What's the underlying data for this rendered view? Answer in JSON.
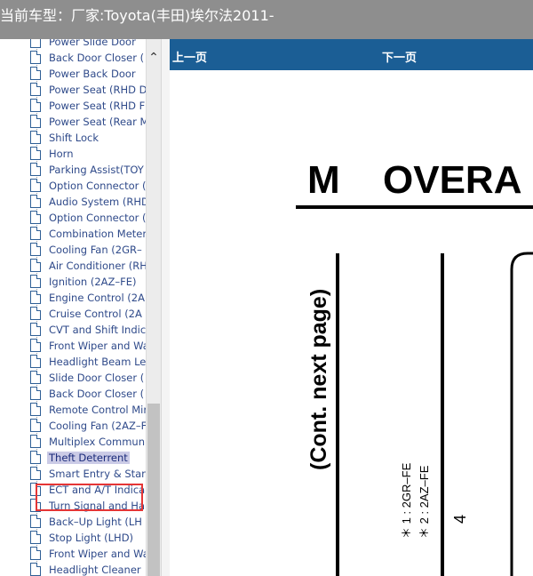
{
  "window": {
    "title": "当前车型：厂家:Toyota(丰田)埃尔法2011-"
  },
  "tree": {
    "items": [
      {
        "label": "Power Slide Door"
      },
      {
        "label": "Back Door Closer ("
      },
      {
        "label": "Power Back Door"
      },
      {
        "label": "Power Seat (RHD D"
      },
      {
        "label": "Power Seat (RHD F"
      },
      {
        "label": "Power Seat (Rear M"
      },
      {
        "label": "Shift Lock"
      },
      {
        "label": "Horn"
      },
      {
        "label": "Parking Assist(TOY"
      },
      {
        "label": "Option Connector ("
      },
      {
        "label": "Audio System (RHD"
      },
      {
        "label": "Option Connector ("
      },
      {
        "label": "Combination Meter"
      },
      {
        "label": "Cooling Fan (2GR–"
      },
      {
        "label": "Air Conditioner (RH"
      },
      {
        "label": "Ignition (2AZ–FE)"
      },
      {
        "label": "Engine Control (2A"
      },
      {
        "label": "Cruise Control (2A"
      },
      {
        "label": "CVT and Shift Indic"
      },
      {
        "label": "Front Wiper and Wa"
      },
      {
        "label": "Headlight Beam Lev"
      },
      {
        "label": "Slide Door Closer ("
      },
      {
        "label": "Back Door Closer ("
      },
      {
        "label": "Remote Control Mir"
      },
      {
        "label": "Cooling Fan (2AZ–F"
      },
      {
        "label": "Multiplex Communi"
      },
      {
        "label": "Theft Deterrent"
      },
      {
        "label": "Smart Entry & Star"
      },
      {
        "label": "ECT and A/T Indica"
      },
      {
        "label": "Turn Signal and Ha"
      },
      {
        "label": "Back–Up Light (LH"
      },
      {
        "label": "Stop Light (LHD)"
      },
      {
        "label": "Front Wiper and Wa"
      },
      {
        "label": "Headlight Cleaner"
      }
    ],
    "selected_index": 26
  },
  "scrollbar": {
    "up_glyph": "⌃"
  },
  "nav": {
    "prev_label": "上一页",
    "next_label": "下一页"
  },
  "diagram": {
    "heading_letter": "M",
    "heading_word": "OVERA",
    "side_note": "(Cont. next page)",
    "note_1": "＊ 1 : 2GR–FE",
    "note_2": "＊ 2 : 2AZ–FE",
    "number": "4"
  }
}
